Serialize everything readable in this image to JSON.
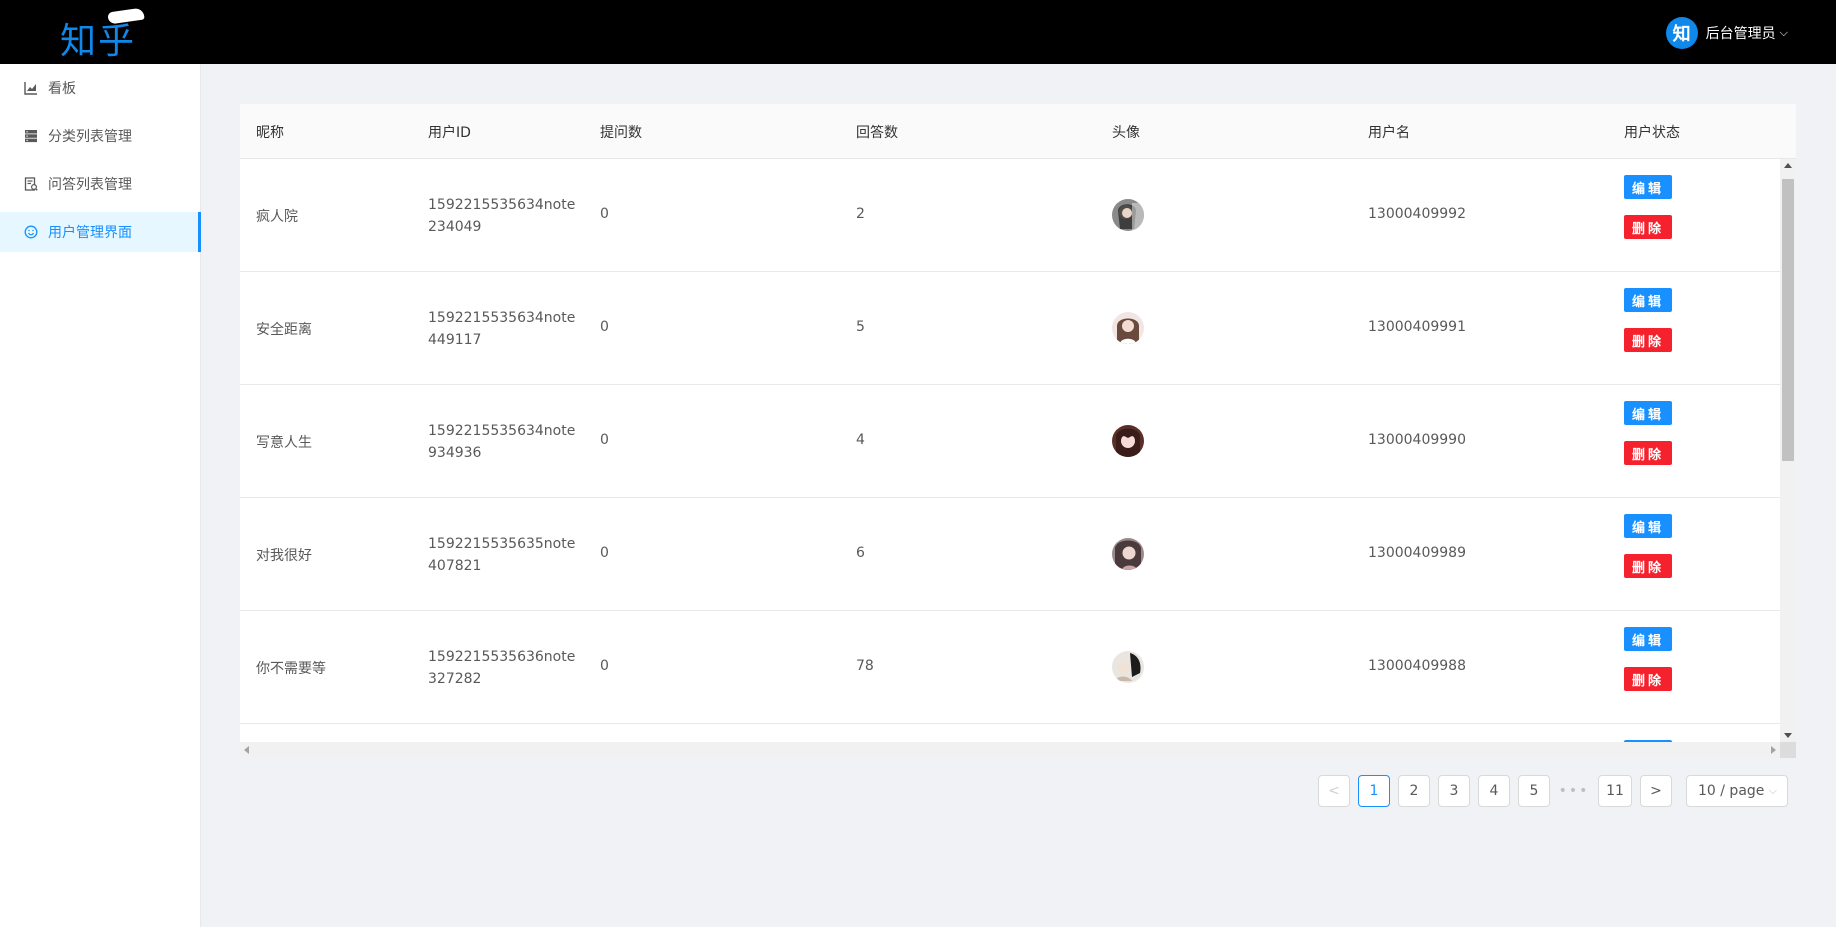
{
  "header": {
    "logo_text": "知乎",
    "user_avatar_text": "知",
    "user_name": "后台管理员",
    "user_caret": "⌵"
  },
  "sidebar": {
    "items": [
      {
        "label": "看板",
        "icon": "chart-icon",
        "active": false
      },
      {
        "label": "分类列表管理",
        "icon": "database-icon",
        "active": false
      },
      {
        "label": "问答列表管理",
        "icon": "audit-icon",
        "active": false
      },
      {
        "label": "用户管理界面",
        "icon": "smile-icon",
        "active": true
      }
    ]
  },
  "table": {
    "columns": [
      "昵称",
      "用户ID",
      "提问数",
      "回答数",
      "头像",
      "用户名",
      "用户状态"
    ],
    "edit_label": "编辑",
    "delete_label": "删除",
    "rows": [
      {
        "nickname": "疯人院",
        "user_id": "1592215535634note234049",
        "questions": "0",
        "answers": "2",
        "avatar": "avatar-1",
        "username": "13000409992"
      },
      {
        "nickname": "安全距离",
        "user_id": "1592215535634note449117",
        "questions": "0",
        "answers": "5",
        "avatar": "avatar-2",
        "username": "13000409991"
      },
      {
        "nickname": "写意人生",
        "user_id": "1592215535634note934936",
        "questions": "0",
        "answers": "4",
        "avatar": "avatar-3",
        "username": "13000409990"
      },
      {
        "nickname": "对我很好",
        "user_id": "1592215535635note407821",
        "questions": "0",
        "answers": "6",
        "avatar": "avatar-4",
        "username": "13000409989"
      },
      {
        "nickname": "你不需要等",
        "user_id": "1592215535636note327282",
        "questions": "0",
        "answers": "78",
        "avatar": "avatar-5",
        "username": "13000409988"
      }
    ]
  },
  "pagination": {
    "prev": "<",
    "pages": [
      "1",
      "2",
      "3",
      "4",
      "5"
    ],
    "ellipsis": "•••",
    "last": "11",
    "next": ">",
    "current": "1",
    "page_size": "10 / page"
  },
  "colors": {
    "primary": "#1890ff",
    "danger": "#f5222d",
    "header_bg": "#000000",
    "logo": "#0f88eb"
  }
}
